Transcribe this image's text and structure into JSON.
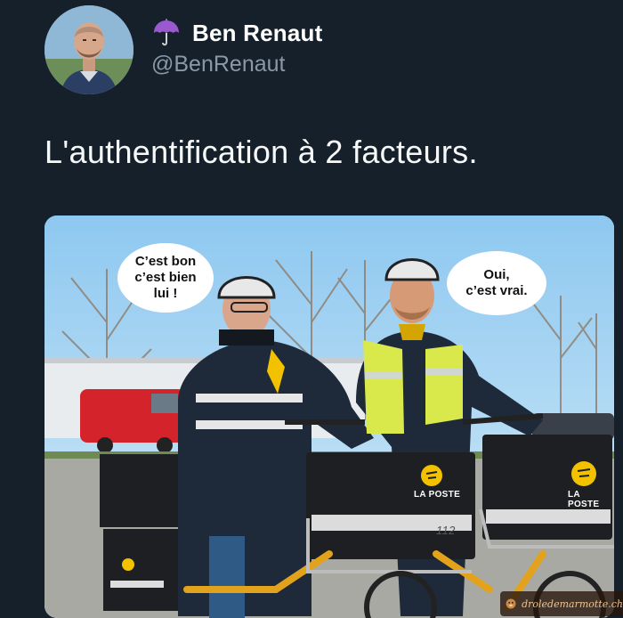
{
  "tweet": {
    "display_name": "Ben Renaut",
    "handle": "@BenRenaut",
    "name_emoji_icon": "umbrella-icon",
    "text": "L'authentification à 2 facteurs."
  },
  "photo": {
    "bubble_left": [
      "C’est bon",
      "c’est bien",
      "lui !"
    ],
    "bubble_right": [
      "Oui,",
      "c’est vrai."
    ],
    "bag_brand": "LA POSTE",
    "bag_handwriting": "112"
  },
  "watermark": {
    "text": "droledemarmotte.ch"
  },
  "colors": {
    "background": "#15202b",
    "name": "#ffffff",
    "handle": "#8b98a5",
    "la_poste_yellow": "#f2c200",
    "bag_black": "#1d1f23"
  }
}
